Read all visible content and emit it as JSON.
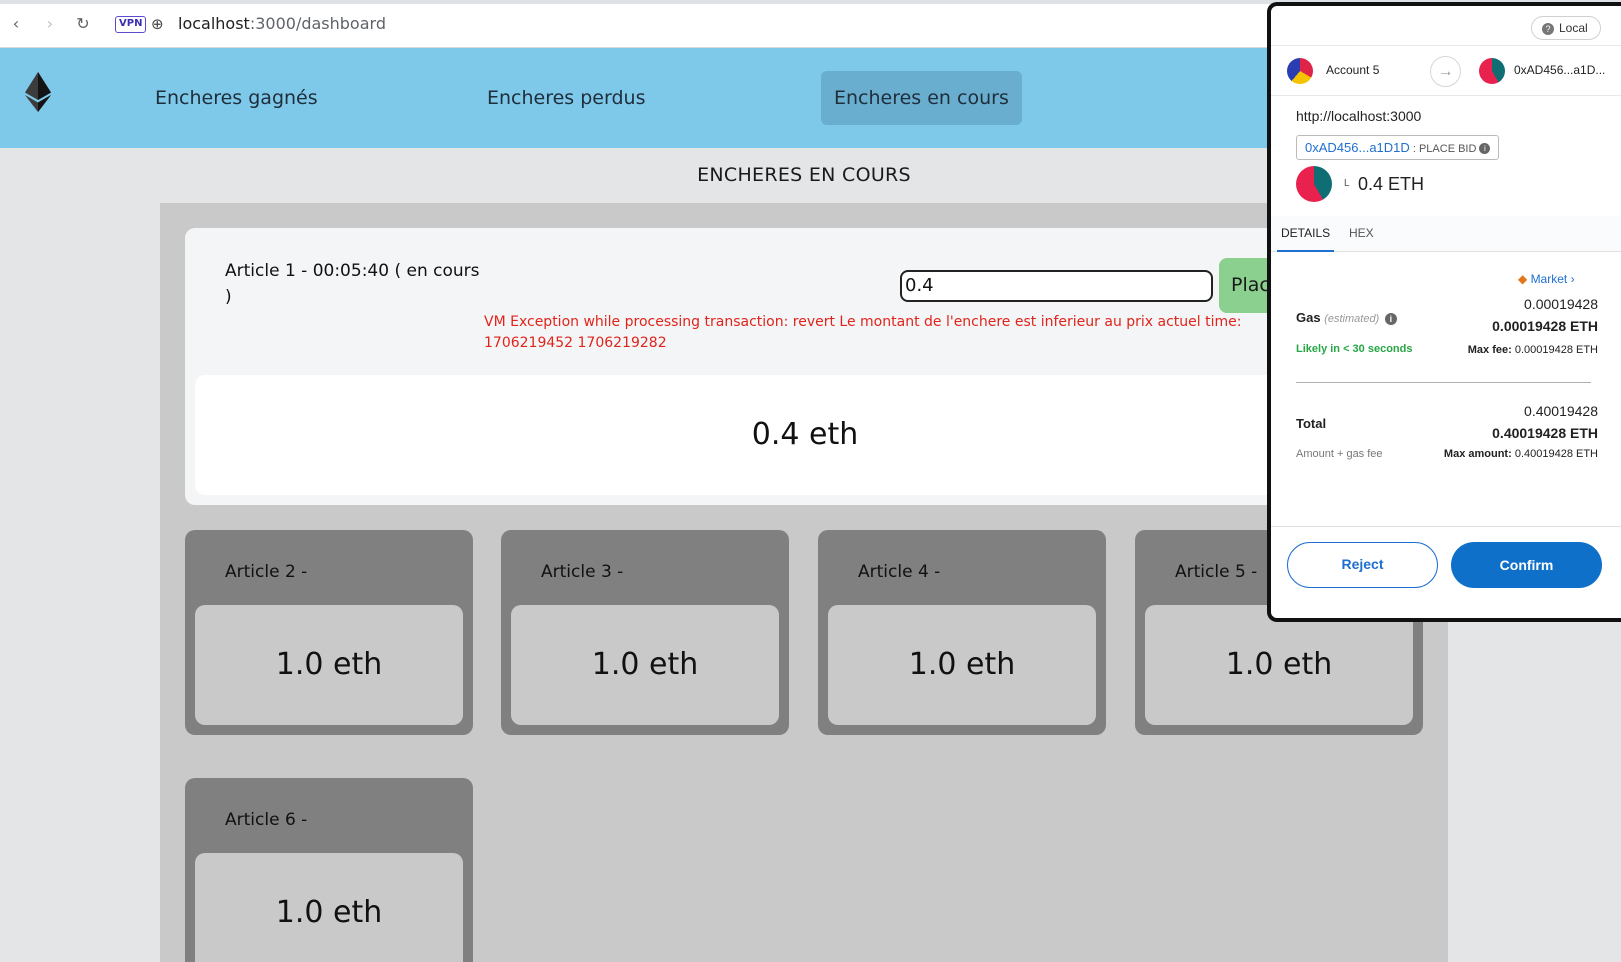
{
  "browser": {
    "back_icon": "‹",
    "forward_icon": "›",
    "reload_icon": "↻",
    "vpn_badge": "VPN",
    "url_host": "localhost",
    "url_path": ":3000/dashboard"
  },
  "header": {
    "nav": [
      {
        "label": "Encheres gagnés",
        "active": false
      },
      {
        "label": "Encheres perdus",
        "active": false
      },
      {
        "label": "Encheres en cours",
        "active": true
      }
    ]
  },
  "main": {
    "title": "ENCHERES EN COURS",
    "active_article": {
      "title": "Article 1 - 00:05:40 ( en cours )",
      "bid_value": "0.4",
      "place_button": "Place Bid",
      "error": "VM Exception while processing transaction: revert Le montant de l'enchere est inferieur au prix actuel time: 1706219452 1706219282",
      "price": "0.4 eth"
    },
    "articles": [
      {
        "label": "Article 2 -",
        "price": "1.0 eth"
      },
      {
        "label": "Article 3 -",
        "price": "1.0 eth"
      },
      {
        "label": "Article 4 -",
        "price": "1.0 eth"
      },
      {
        "label": "Article 5 -",
        "price": "1.0 eth"
      },
      {
        "label": "Article 6 -",
        "price": "1.0 eth"
      }
    ]
  },
  "metamask": {
    "network": "Local",
    "from_account": "Account 5",
    "to_address": "0xAD456...a1D...",
    "origin": "http://localhost:3000",
    "contract_chip": "0xAD456...a1D1D",
    "method": "PLACE BID",
    "amount_prefix": "L",
    "amount": "0.4 ETH",
    "tabs": [
      "DETAILS",
      "HEX"
    ],
    "market_label": "Market",
    "gas_label": "Gas",
    "gas_estimated": "(estimated)",
    "gas_value": "0.00019428",
    "gas_eth": "0.00019428 ETH",
    "likely": "Likely in < 30 seconds",
    "max_fee_label": "Max fee:",
    "max_fee_value": "0.00019428 ETH",
    "total_label": "Total",
    "total_value": "0.40019428",
    "total_eth": "0.40019428 ETH",
    "amount_gas": "Amount + gas fee",
    "max_amount_label": "Max amount:",
    "max_amount_value": "0.40019428 ETH",
    "reject": "Reject",
    "confirm": "Confirm"
  }
}
